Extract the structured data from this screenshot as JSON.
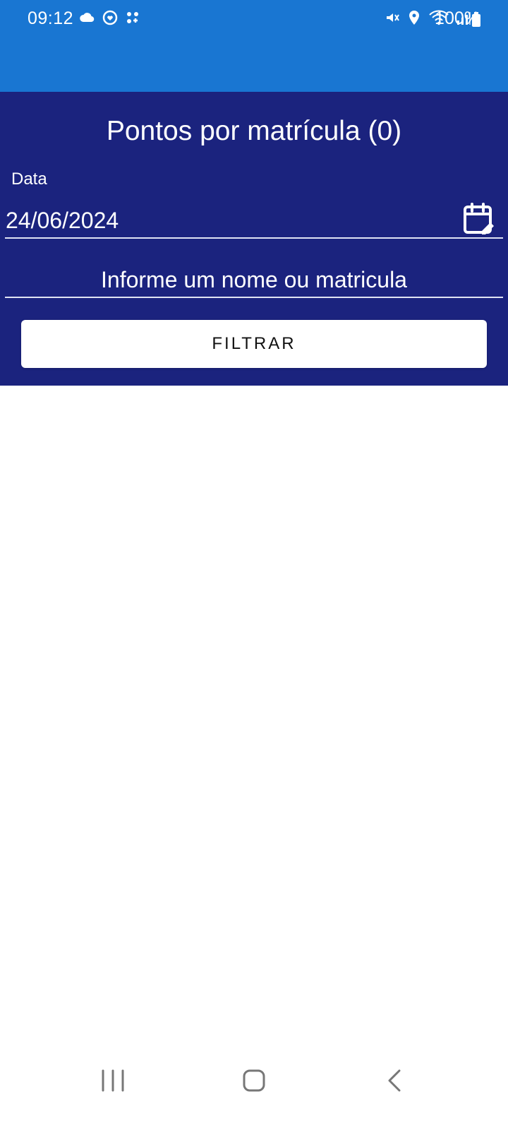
{
  "status_bar": {
    "time": "09:12",
    "battery_text": "100%",
    "left_icons": [
      "cloud-icon",
      "heart-sync-icon",
      "apps-icon"
    ],
    "right_icons": [
      "mute-icon",
      "location-icon",
      "wifi-icon",
      "signal-icon"
    ]
  },
  "header": {
    "title": "Pontos por matrícula (0)",
    "date_label": "Data",
    "date_value": "24/06/2024",
    "search_placeholder": "Informe um nome ou matricula",
    "filter_label": "FILTRAR"
  },
  "theme": {
    "status_bar_color": "#1976d2",
    "header_color": "#1b237e",
    "button_color": "#ffffff"
  },
  "navigation": {
    "icons": [
      "recents-icon",
      "home-icon",
      "back-icon"
    ]
  }
}
